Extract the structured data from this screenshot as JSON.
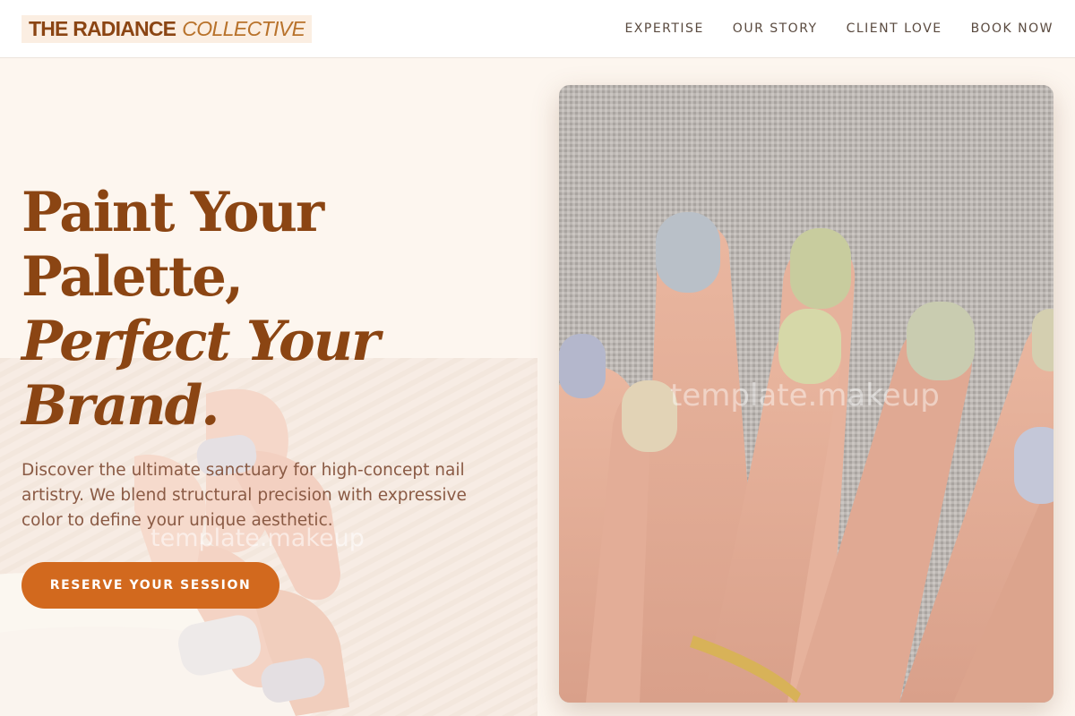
{
  "brand": {
    "name": "THE RADIANCE",
    "accent": "COLLECTIVE"
  },
  "nav": [
    {
      "label": "EXPERTISE"
    },
    {
      "label": "OUR STORY"
    },
    {
      "label": "CLIENT LOVE"
    },
    {
      "label": "BOOK NOW"
    }
  ],
  "hero": {
    "headline": {
      "line1": "Paint Your",
      "line2": "Palette,",
      "line3": "Perfect Your",
      "line4": "Brand."
    },
    "intro": "Discover the ultimate sanctuary for high-concept nail artistry. We blend structural precision with expressive color to define your unique aesthetic.",
    "cta_label": "RESERVE YOUR SESSION"
  },
  "watermark": "template.makeup",
  "colors": {
    "brand_brown": "#8b4513",
    "accent_orange": "#d2691e",
    "background": "#fdf6ef",
    "body_text": "#8a5a44"
  }
}
